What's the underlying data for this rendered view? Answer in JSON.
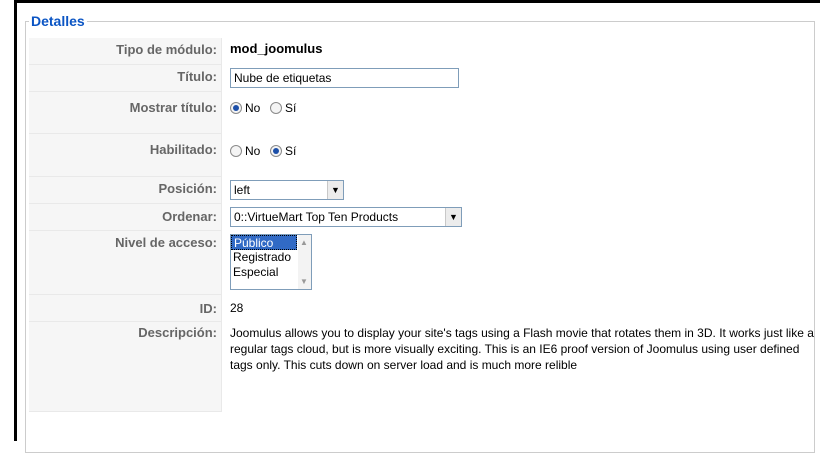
{
  "fieldset": {
    "legend": "Detalles"
  },
  "rows": {
    "module_type": {
      "label": "Tipo de módulo:",
      "value": "mod_joomulus"
    },
    "title": {
      "label": "Título:",
      "value": "Nube de etiquetas"
    },
    "show_title": {
      "label": "Mostrar título:",
      "no": "No",
      "yes": "Sí",
      "selected": "No"
    },
    "enabled": {
      "label": "Habilitado:",
      "no": "No",
      "yes": "Sí",
      "selected": "Sí"
    },
    "position": {
      "label": "Posición:",
      "value": "left"
    },
    "order": {
      "label": "Ordenar:",
      "value": "0::VirtueMart Top Ten Products"
    },
    "access": {
      "label": "Nivel de acceso:",
      "options": [
        "Público",
        "Registrado",
        "Especial"
      ],
      "selected": "Público"
    },
    "id": {
      "label": "ID:",
      "value": "28"
    },
    "description": {
      "label": "Descripción:",
      "value": "Joomulus allows you to display your site's tags using a Flash movie that rotates them in 3D. It works just like a regular tags cloud, but is more visually exciting. This is an IE6 proof version of Joomulus using user defined tags only. This cuts down on server load and is much more relible"
    }
  },
  "icons": {
    "dropdown": "chevron-down-icon",
    "scroll_up": "scroll-up-icon",
    "scroll_down": "scroll-down-icon"
  }
}
